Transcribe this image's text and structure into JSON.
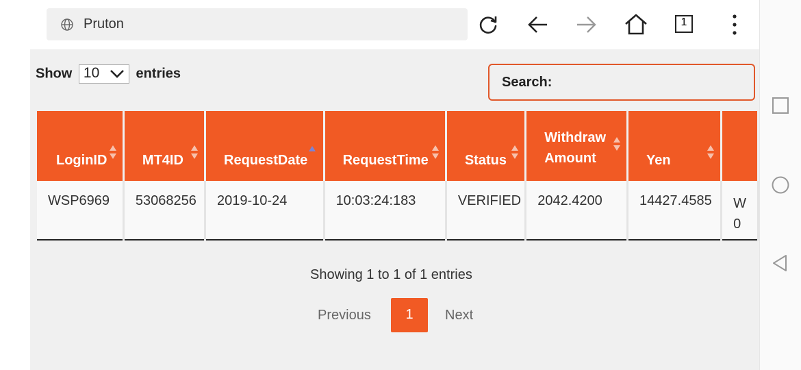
{
  "browser": {
    "url": "Pruton",
    "tab_count": "1"
  },
  "table_controls": {
    "show_label": "Show",
    "page_size": "10",
    "entries_label": "entries",
    "search_label": "Search:"
  },
  "table": {
    "headers": [
      "LoginID",
      "MT4ID",
      "RequestDate",
      "RequestTime",
      "Status",
      "Withdraw Amount",
      "Yen",
      ""
    ],
    "rows": [
      [
        "WSP6969",
        "53068256",
        "2019-10-24",
        "10:03:24:183",
        "VERIFIED",
        "2042.4200",
        "14427.4585",
        "W 0"
      ]
    ]
  },
  "pagination": {
    "info": "Showing 1 to 1 of 1 entries",
    "previous": "Previous",
    "current_page": "1",
    "next": "Next"
  },
  "colors": {
    "accent": "#f15a24",
    "content_bg": "#f0f0f0"
  }
}
